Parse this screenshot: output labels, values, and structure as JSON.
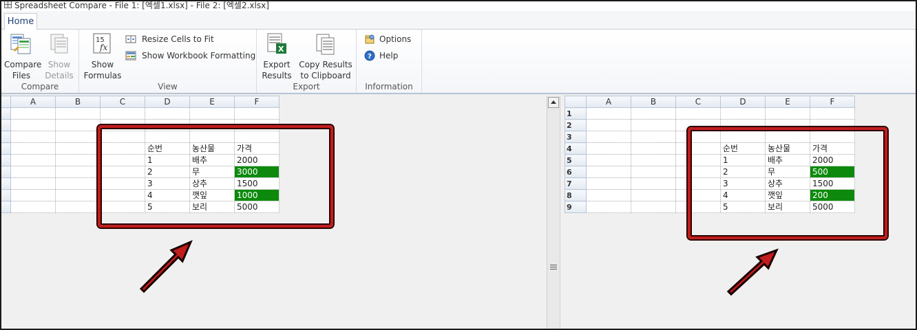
{
  "window": {
    "title": "Spreadsheet Compare - File 1: [엑셀1.xlsx] - File 2: [엑셀2.xlsx]"
  },
  "tabs": [
    {
      "label": "Home"
    }
  ],
  "ribbon": {
    "compare": {
      "label": "Compare",
      "compare_files": [
        "Compare",
        "Files"
      ],
      "show_details": [
        "Show",
        "Details"
      ]
    },
    "view": {
      "label": "View",
      "show_formulas": [
        "Show",
        "Formulas"
      ],
      "resize_cells": "Resize Cells to Fit",
      "show_workbook_formatting": "Show Workbook Formatting"
    },
    "export": {
      "label": "Export",
      "export_results": [
        "Export",
        "Results"
      ],
      "copy_results": [
        "Copy Results",
        "to Clipboard"
      ]
    },
    "information": {
      "label": "Information",
      "options": "Options",
      "help": "Help"
    }
  },
  "columns": [
    "A",
    "B",
    "C",
    "D",
    "E",
    "F"
  ],
  "rows": [
    "1",
    "2",
    "3",
    "4",
    "5",
    "6",
    "7",
    "8",
    "9"
  ],
  "left_sheet": {
    "cells": [
      [
        "",
        "",
        "",
        "",
        "",
        ""
      ],
      [
        "",
        "",
        "",
        "",
        "",
        ""
      ],
      [
        "",
        "",
        "",
        "",
        "",
        ""
      ],
      [
        "",
        "",
        "",
        "순번",
        "농산물",
        "가격"
      ],
      [
        "",
        "",
        "",
        "1",
        "배추",
        "2000"
      ],
      [
        "",
        "",
        "",
        "2",
        "무",
        "3000"
      ],
      [
        "",
        "",
        "",
        "3",
        "상추",
        "1500"
      ],
      [
        "",
        "",
        "",
        "4",
        "깻잎",
        "1000"
      ],
      [
        "",
        "",
        "",
        "5",
        "보리",
        "5000"
      ]
    ]
  },
  "right_sheet": {
    "cells": [
      [
        "",
        "",
        "",
        "",
        "",
        ""
      ],
      [
        "",
        "",
        "",
        "",
        "",
        ""
      ],
      [
        "",
        "",
        "",
        "",
        "",
        ""
      ],
      [
        "",
        "",
        "",
        "순번",
        "농산물",
        "가격"
      ],
      [
        "",
        "",
        "",
        "1",
        "배추",
        "2000"
      ],
      [
        "",
        "",
        "",
        "2",
        "무",
        "500"
      ],
      [
        "",
        "",
        "",
        "3",
        "상추",
        "1500"
      ],
      [
        "",
        "",
        "",
        "4",
        "깻잎",
        "200"
      ],
      [
        "",
        "",
        "",
        "5",
        "보리",
        "5000"
      ]
    ]
  },
  "diff_cells": [
    [
      5,
      5
    ],
    [
      7,
      5
    ]
  ],
  "colors": {
    "diff_highlight": "#0d8a0d",
    "annotation_red": "#c21d1d"
  }
}
